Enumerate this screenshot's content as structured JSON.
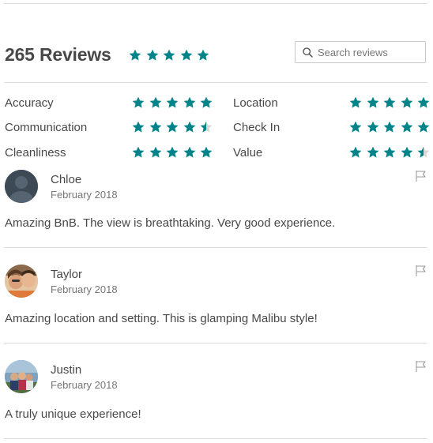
{
  "header": {
    "title": "265 Reviews",
    "overall_stars": 5,
    "search_placeholder": "Search reviews"
  },
  "colors": {
    "accent": "#008489",
    "empty_star": "#d8d8d8",
    "divider": "#dcdcdc"
  },
  "categories": [
    {
      "label": "Accuracy",
      "stars": 5
    },
    {
      "label": "Location",
      "stars": 5
    },
    {
      "label": "Communication",
      "stars": 4.5
    },
    {
      "label": "Check In",
      "stars": 5
    },
    {
      "label": "Cleanliness",
      "stars": 5
    },
    {
      "label": "Value",
      "stars": 4.5
    }
  ],
  "reviews": [
    {
      "name": "Chloe",
      "date": "February 2018",
      "text": "Amazing BnB. The view is breathtaking. Very good experience.",
      "avatar": "default-avatar-icon"
    },
    {
      "name": "Taylor",
      "date": "February 2018",
      "text": "Amazing location and setting. This is glamping Malibu style!",
      "avatar": "couple-photo"
    },
    {
      "name": "Justin",
      "date": "February 2018",
      "text": "A truly unique experience!",
      "avatar": "group-photo"
    }
  ],
  "icons": {
    "search": "search-icon",
    "flag": "flag-icon",
    "star": "star-icon"
  }
}
